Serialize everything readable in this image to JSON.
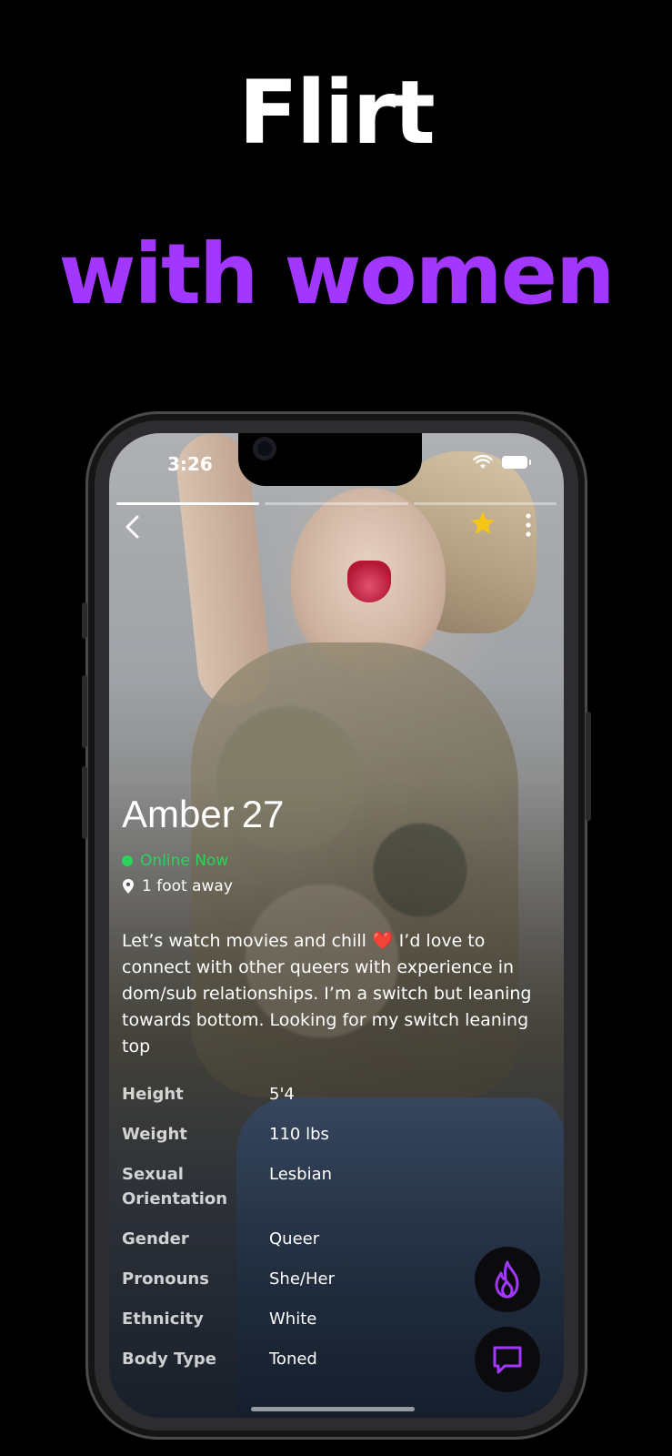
{
  "promo": {
    "line1": "Flirt",
    "line2": "with women",
    "line1_color": "#ffffff",
    "line2_color": "#a238ff"
  },
  "status_bar": {
    "time": "3:26",
    "icons": [
      "wifi-icon",
      "battery-icon"
    ]
  },
  "story": {
    "segments": 3,
    "active_segment": 1
  },
  "toolbar": {
    "back_icon": "chevron-left-icon",
    "favorite_icon": "star-icon",
    "favorite_color": "#f5c518",
    "more_icon": "more-vertical-icon"
  },
  "profile": {
    "name": "Amber",
    "age": "27",
    "status": "Online Now",
    "status_color": "#2bd45a",
    "distance": "1 foot away",
    "bio_before_heart": "Let’s watch movies and chill ",
    "bio_heart": "❤️",
    "bio_after_heart": " I’d love to connect with other queers with experience in dom/sub relationships. I’m a switch but leaning towards bottom. Looking for my switch leaning top",
    "attributes": [
      {
        "label": "Height",
        "value": "5'4"
      },
      {
        "label": "Weight",
        "value": "110 lbs"
      },
      {
        "label": "Sexual Orientation",
        "value": "Lesbian"
      },
      {
        "label": "Gender",
        "value": "Queer"
      },
      {
        "label": "Pronouns",
        "value": "She/Her"
      },
      {
        "label": "Ethnicity",
        "value": "White"
      },
      {
        "label": "Body Type",
        "value": "Toned"
      }
    ]
  },
  "actions": {
    "flame_icon": "flame-icon",
    "chat_icon": "chat-bubble-icon",
    "accent_color": "#a238ff"
  }
}
